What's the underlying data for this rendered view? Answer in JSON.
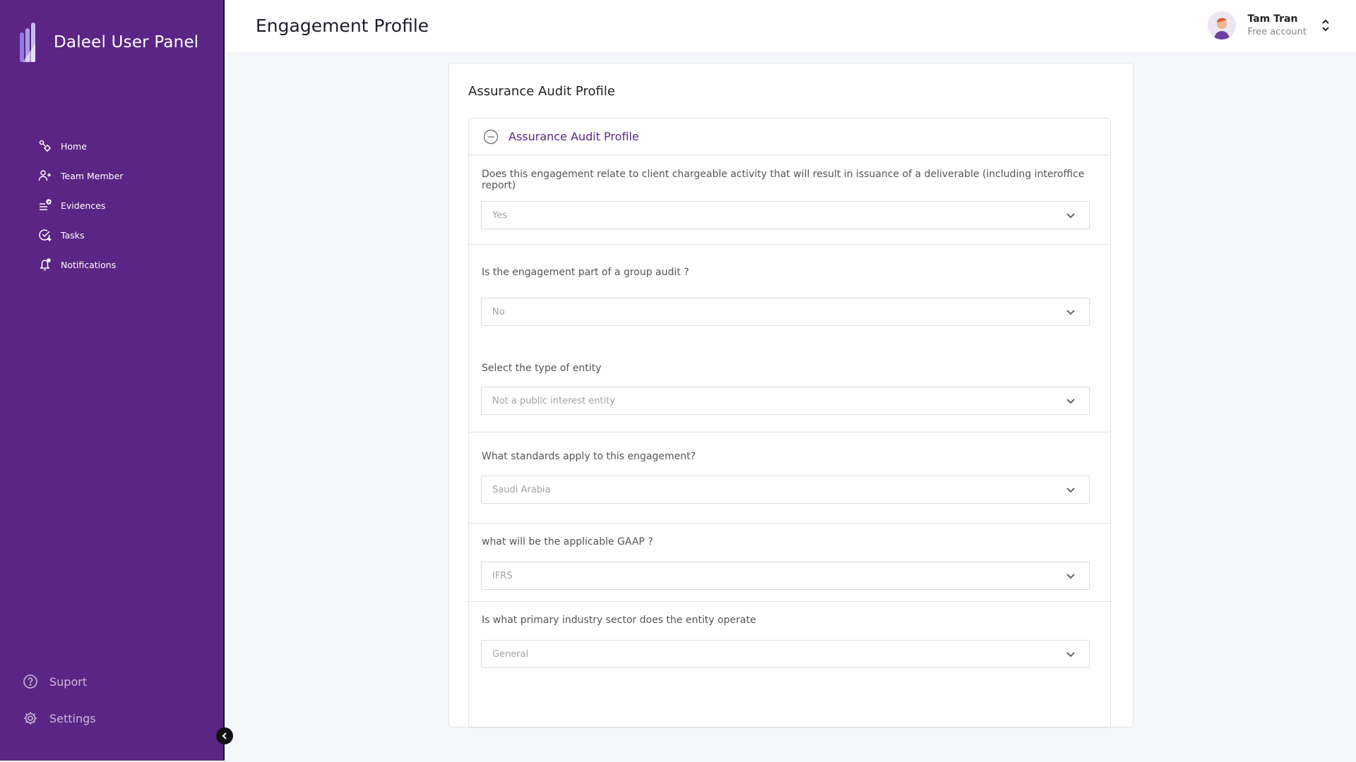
{
  "sidebar": {
    "brand_title": "Daleel User Panel",
    "nav": [
      {
        "label": "Home",
        "icon": "home-icon"
      },
      {
        "label": "Team Member",
        "icon": "team-icon"
      },
      {
        "label": "Evidences",
        "icon": "evidences-icon"
      },
      {
        "label": "Tasks",
        "icon": "tasks-icon"
      },
      {
        "label": "Notifications",
        "icon": "bell-icon"
      }
    ],
    "bottom": [
      {
        "label": "Suport",
        "icon": "help-icon"
      },
      {
        "label": "Settings",
        "icon": "gear-icon"
      }
    ],
    "bg_color": "#5b2585"
  },
  "header": {
    "title": "Engagement Profile",
    "user": {
      "name": "Tam Tran",
      "plan": "Free account"
    }
  },
  "card": {
    "title": "Assurance Audit Profile",
    "section_title": "Assurance Audit Profile",
    "questions": [
      {
        "label": "Does this engagement relate to client chargeable activity  that will result in issuance of a deliverable (including interoffice report)",
        "value": "Yes"
      },
      {
        "label": "Is the engagement part of a group audit ?",
        "value": "No"
      },
      {
        "label": "Select the type of entity",
        "value": "Not a public interest entity"
      },
      {
        "label": "What standards apply to this engagement?",
        "value": "Saudi Arabia"
      },
      {
        "label": "what will be the applicable GAAP ?",
        "value": "IFRS"
      },
      {
        "label": "Is what primary industry sector does the entity operate",
        "value": "General"
      }
    ]
  },
  "colors": {
    "accent": "#5b2585",
    "bg": "#f5f6fa"
  }
}
